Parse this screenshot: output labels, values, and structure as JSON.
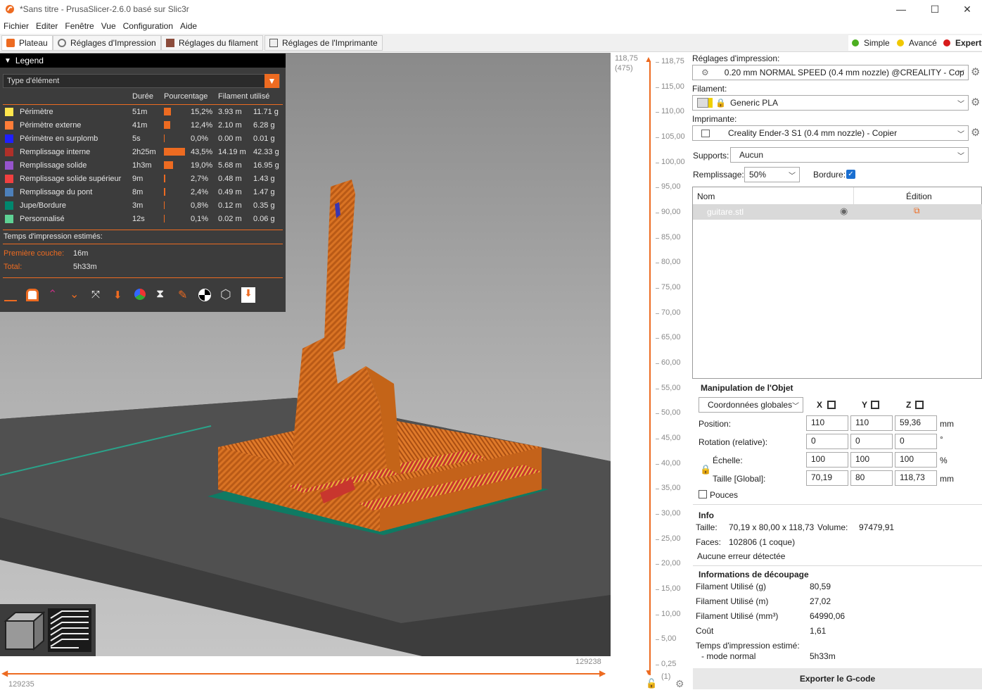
{
  "window": {
    "title": "*Sans titre - PrusaSlicer-2.6.0 basé sur Slic3r",
    "minimize": "—",
    "maximize": "☐",
    "close": "✕"
  },
  "menu": [
    "Fichier",
    "Editer",
    "Fenêtre",
    "Vue",
    "Configuration",
    "Aide"
  ],
  "tabs": [
    "Plateau",
    "Réglages d'Impression",
    "Réglages du filament",
    "Réglages de l'Imprimante"
  ],
  "modes": [
    "Simple",
    "Avancé",
    "Expert"
  ],
  "colors": {
    "accent": "#ed6b21",
    "simple": "#4caf20",
    "avance": "#f0c800",
    "expert": "#d81b1b"
  },
  "legend": {
    "title": "Legend",
    "view_type": "Type d'élément",
    "columns": [
      "Durée",
      "Pourcentage",
      "Filament utilisé"
    ],
    "rows": [
      {
        "name": "Périmètre",
        "color": "#ffe64d",
        "time": "51m",
        "pct": 15.2,
        "pct_text": "15,2%",
        "len": "3.93 m",
        "weight": "11.71 g"
      },
      {
        "name": "Périmètre externe",
        "color": "#ff7d38",
        "time": "41m",
        "pct": 12.4,
        "pct_text": "12,4%",
        "len": "2.10 m",
        "weight": "6.28 g"
      },
      {
        "name": "Périmètre en surplomb",
        "color": "#1f1fff",
        "time": "5s",
        "pct": 0.0,
        "pct_text": "0,0%",
        "len": "0.00 m",
        "weight": "0.01 g"
      },
      {
        "name": "Remplissage interne",
        "color": "#b03029",
        "time": "2h25m",
        "pct": 43.5,
        "pct_text": "43,5%",
        "len": "14.19 m",
        "weight": "42.33 g"
      },
      {
        "name": "Remplissage solide",
        "color": "#9654cc",
        "time": "1h3m",
        "pct": 19.0,
        "pct_text": "19,0%",
        "len": "5.68 m",
        "weight": "16.95 g"
      },
      {
        "name": "Remplissage solide supérieur",
        "color": "#f04040",
        "time": "9m",
        "pct": 2.7,
        "pct_text": "2,7%",
        "len": "0.48 m",
        "weight": "1.43 g"
      },
      {
        "name": "Remplissage du pont",
        "color": "#4d80ba",
        "time": "8m",
        "pct": 2.4,
        "pct_text": "2,4%",
        "len": "0.49 m",
        "weight": "1.47 g"
      },
      {
        "name": "Jupe/Bordure",
        "color": "#00876e",
        "time": "3m",
        "pct": 0.8,
        "pct_text": "0,8%",
        "len": "0.12 m",
        "weight": "0.35 g"
      },
      {
        "name": "Personnalisé",
        "color": "#5ed194",
        "time": "12s",
        "pct": 0.1,
        "pct_text": "0,1%",
        "len": "0.02 m",
        "weight": "0.06 g"
      }
    ],
    "estimated_label": "Temps d'impression estimés:",
    "first_layer_label": "Première couche:",
    "first_layer_value": "16m",
    "total_label": "Total:",
    "total_value": "5h33m"
  },
  "ruler": {
    "top_value": "118,75",
    "top_layer": "(475)",
    "ticks": [
      "118,75",
      "115,00",
      "110,00",
      "105,00",
      "100,00",
      "95,00",
      "90,00",
      "85,00",
      "80,00",
      "75,00",
      "70,00",
      "65,00",
      "60,00",
      "55,00",
      "50,00",
      "45,00",
      "40,00",
      "35,00",
      "30,00",
      "25,00",
      "20,00",
      "15,00",
      "10,00",
      "5,00",
      "0,25"
    ],
    "bottom_layer": "(1)"
  },
  "bottom_slider": {
    "right_value": "129238",
    "left_value": "129235"
  },
  "panel": {
    "print_label": "Réglages d'impression:",
    "print_value": "0.20 mm NORMAL SPEED (0.4 mm nozzle) @CREALITY - Cop",
    "filament_label": "Filament:",
    "filament_value": "Generic PLA",
    "printer_label": "Imprimante:",
    "printer_value": "Creality Ender-3 S1 (0.4 mm nozzle) - Copier",
    "supports_label": "Supports:",
    "supports_value": "Aucun",
    "infill_label": "Remplissage:",
    "infill_value": "50%",
    "brim_label": "Bordure:",
    "objlist": {
      "col_name": "Nom",
      "col_edit": "Édition",
      "item": "guitare.stl"
    },
    "manip": {
      "title": "Manipulation de l'Objet",
      "coords": "Coordonnées globales",
      "axes": [
        "X",
        "Y",
        "Z"
      ],
      "position_label": "Position:",
      "position": [
        "110",
        "110",
        "59,36"
      ],
      "position_unit": "mm",
      "rotation_label": "Rotation (relative):",
      "rotation": [
        "0",
        "0",
        "0"
      ],
      "rotation_unit": "°",
      "scale_label": "Échelle:",
      "scale": [
        "100",
        "100",
        "100"
      ],
      "scale_unit": "%",
      "size_label": "Taille [Global]:",
      "size": [
        "70,19",
        "80",
        "118,73"
      ],
      "size_unit": "mm",
      "inches_label": "Pouces"
    },
    "info": {
      "title": "Info",
      "size_label": "Taille:",
      "size_value": "70,19 x 80,00 x 118,73",
      "volume_label": "Volume:",
      "volume_value": "97479,91",
      "faces_label": "Faces:",
      "faces_value": "102806 (1 coque)",
      "errors": "Aucune erreur détectée"
    },
    "slice": {
      "title": "Informations de découpage",
      "rows": [
        {
          "label": "Filament Utilisé (g)",
          "value": "80,59"
        },
        {
          "label": "Filament Utilisé (m)",
          "value": "27,02"
        },
        {
          "label": "Filament Utilisé (mm³)",
          "value": "64990,06"
        },
        {
          "label": "Coût",
          "value": "1,61"
        }
      ],
      "time_label": "Temps d'impression estimé:",
      "mode_label": "- mode normal",
      "mode_value": "5h33m"
    },
    "export": "Exporter le G-code"
  }
}
